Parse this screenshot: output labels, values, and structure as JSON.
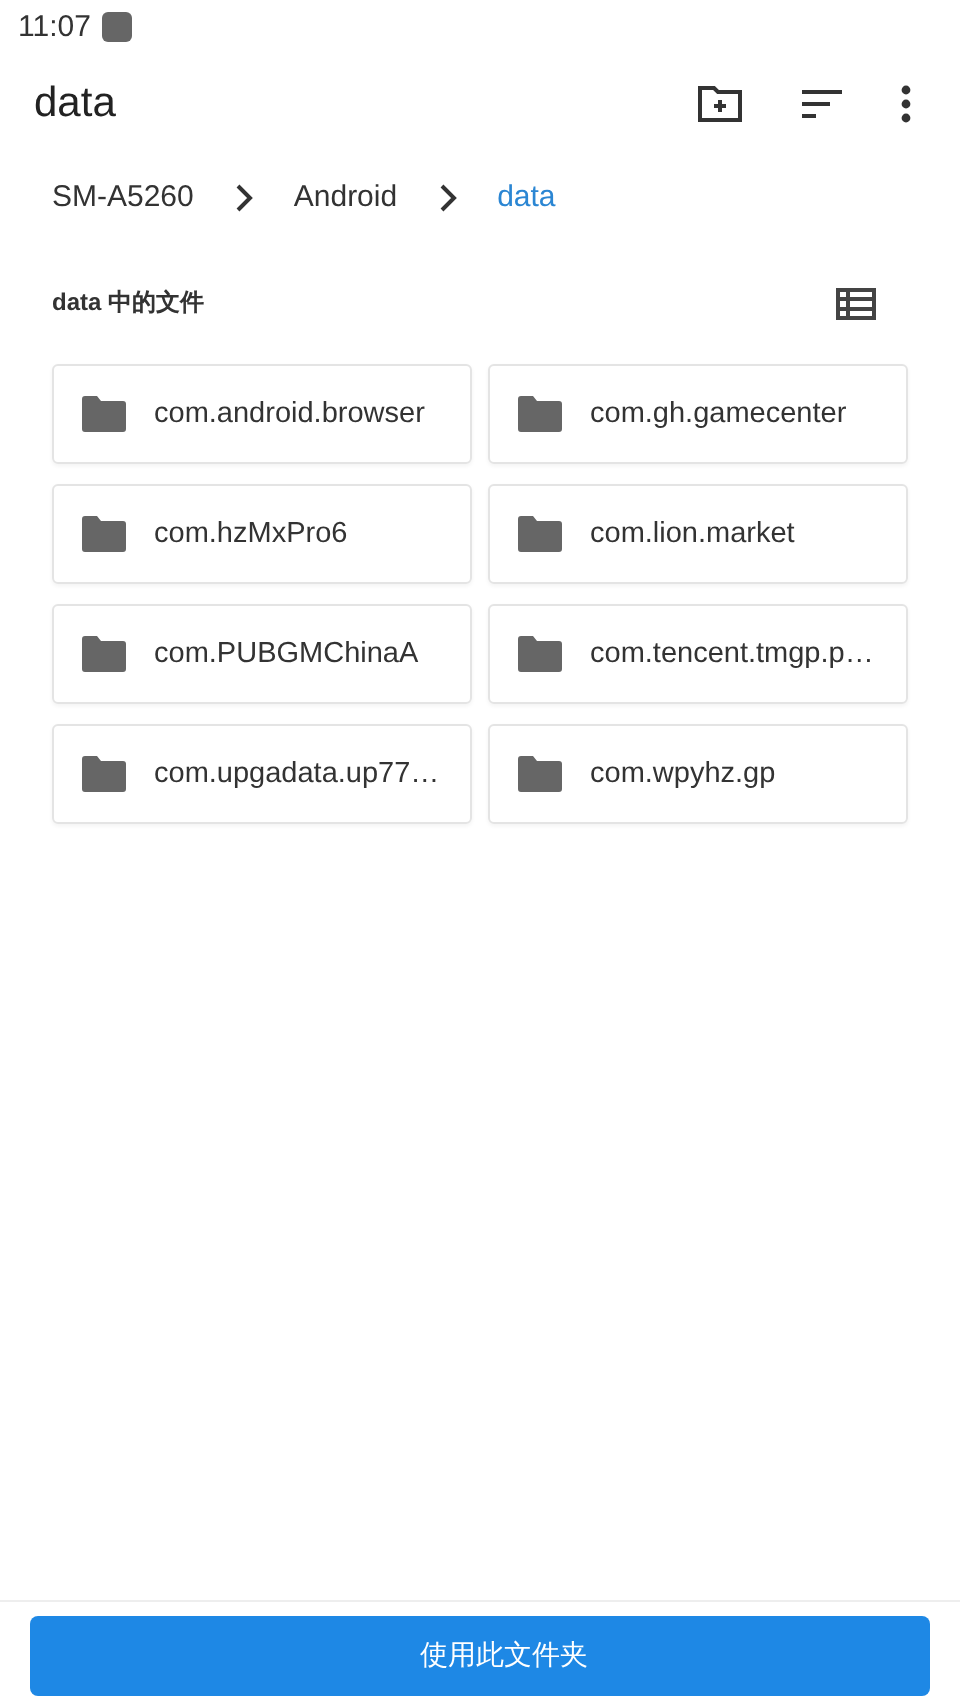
{
  "status_bar": {
    "time": "11:07"
  },
  "app_bar": {
    "title": "data"
  },
  "breadcrumbs": [
    {
      "label": "SM-A5260",
      "selected": false
    },
    {
      "label": "Android",
      "selected": false
    },
    {
      "label": "data",
      "selected": true
    }
  ],
  "section": {
    "title": "data 中的文件"
  },
  "folders": [
    {
      "name": "com.android.browser"
    },
    {
      "name": "com.gh.gamecenter"
    },
    {
      "name": "com.hzMxPro6"
    },
    {
      "name": "com.lion.market"
    },
    {
      "name": "com.PUBGMChinaA"
    },
    {
      "name": "com.tencent.tmgp.p…"
    },
    {
      "name": "com.upgadata.up77…"
    },
    {
      "name": "com.wpyhz.gp"
    }
  ],
  "bottom_button": {
    "label": "使用此文件夹"
  }
}
